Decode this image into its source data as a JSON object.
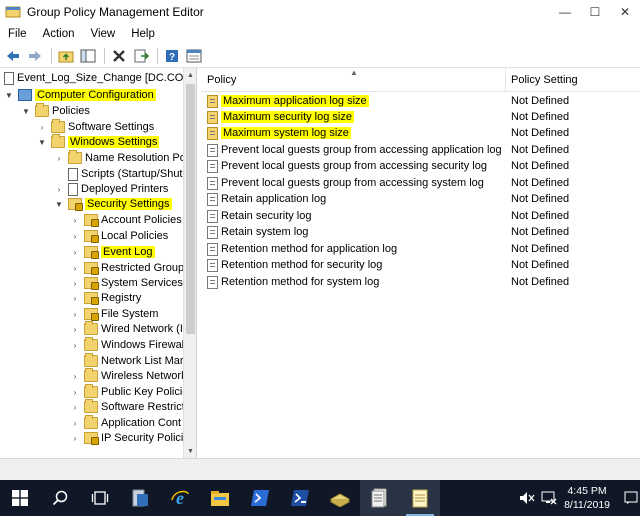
{
  "window": {
    "title": "Group Policy Management Editor",
    "minimize_glyph": "—",
    "maximize_glyph": "☐",
    "close_glyph": "✕"
  },
  "menu": [
    "File",
    "Action",
    "View",
    "Help"
  ],
  "toolbar": {
    "icons": [
      "back-arrow-icon",
      "forward-arrow-icon",
      "up-folder-icon",
      "show-hide-tree-icon",
      "delete-icon",
      "export-list-icon",
      "help-icon",
      "properties-icon"
    ]
  },
  "tree": {
    "items": [
      {
        "label": "Event_Log_Size_Change [DC.CONTO",
        "highlight": false
      },
      {
        "label": "Computer Configuration",
        "highlight": true
      },
      {
        "label": "Policies",
        "highlight": false
      },
      {
        "label": "Software Settings",
        "highlight": false
      },
      {
        "label": "Windows Settings",
        "highlight": true
      },
      {
        "label": "Name Resolution Po",
        "highlight": false
      },
      {
        "label": "Scripts (Startup/Shut",
        "highlight": false
      },
      {
        "label": "Deployed Printers",
        "highlight": false
      },
      {
        "label": "Security Settings",
        "highlight": true
      },
      {
        "label": "Account Policies",
        "highlight": false
      },
      {
        "label": "Local Policies",
        "highlight": false
      },
      {
        "label": "Event Log",
        "highlight": true
      },
      {
        "label": "Restricted Groups",
        "highlight": false
      },
      {
        "label": "System Services",
        "highlight": false
      },
      {
        "label": "Registry",
        "highlight": false
      },
      {
        "label": "File System",
        "highlight": false
      },
      {
        "label": "Wired Network (I",
        "highlight": false
      },
      {
        "label": "Windows Firewal",
        "highlight": false
      },
      {
        "label": "Network List Mar",
        "highlight": false
      },
      {
        "label": "Wireless Network",
        "highlight": false
      },
      {
        "label": "Public Key Policie",
        "highlight": false
      },
      {
        "label": "Software Restricti",
        "highlight": false
      },
      {
        "label": "Application Cont",
        "highlight": false
      },
      {
        "label": "IP Security Policie",
        "highlight": false
      }
    ]
  },
  "list": {
    "columns": {
      "policy": "Policy",
      "setting": "Policy Setting"
    },
    "rows": [
      {
        "policy": "Maximum application log size",
        "setting": "Not Defined",
        "highlight": true
      },
      {
        "policy": "Maximum security log size",
        "setting": "Not Defined",
        "highlight": true
      },
      {
        "policy": "Maximum system log size",
        "setting": "Not Defined",
        "highlight": true
      },
      {
        "policy": "Prevent local guests group from accessing application log",
        "setting": "Not Defined",
        "highlight": false
      },
      {
        "policy": "Prevent local guests group from accessing security log",
        "setting": "Not Defined",
        "highlight": false
      },
      {
        "policy": "Prevent local guests group from accessing system log",
        "setting": "Not Defined",
        "highlight": false
      },
      {
        "policy": "Retain application log",
        "setting": "Not Defined",
        "highlight": false
      },
      {
        "policy": "Retain security log",
        "setting": "Not Defined",
        "highlight": false
      },
      {
        "policy": "Retain system log",
        "setting": "Not Defined",
        "highlight": false
      },
      {
        "policy": "Retention method for application log",
        "setting": "Not Defined",
        "highlight": false
      },
      {
        "policy": "Retention method for security log",
        "setting": "Not Defined",
        "highlight": false
      },
      {
        "policy": "Retention method for system log",
        "setting": "Not Defined",
        "highlight": false
      }
    ]
  },
  "taskbar": {
    "time": "4:45 PM",
    "date": "8/11/2019",
    "icons": [
      "windows-start-icon",
      "search-icon",
      "task-view-icon",
      "server-manager-icon",
      "internet-explorer-icon",
      "file-explorer-icon",
      "powershell-icon",
      "powershell-ise-icon",
      "gpmc-icon",
      "gp-editor-icon",
      "notepad-icon"
    ]
  },
  "colors": {
    "highlight": "#ffff00",
    "taskbar": "#101827",
    "folder": "#f3d36e"
  }
}
